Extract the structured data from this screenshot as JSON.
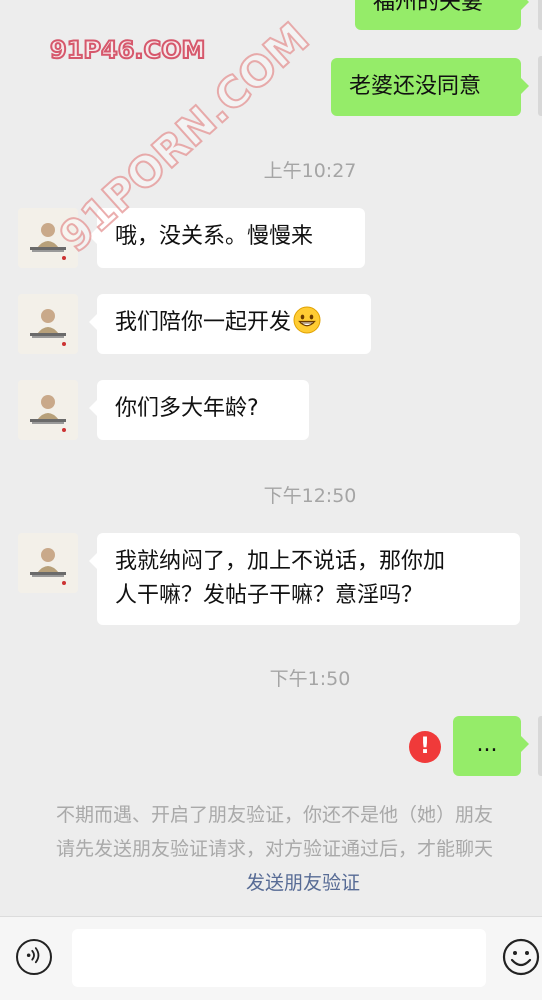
{
  "watermark": {
    "top": "91P46.COM",
    "diagonal": "91PORN.COM"
  },
  "messages": [
    {
      "side": "right",
      "text": "福州的夫妻",
      "partial": true
    },
    {
      "side": "right",
      "text": "老婆还没同意"
    },
    {
      "type": "time",
      "text": "上午10:27"
    },
    {
      "side": "left",
      "text": "哦，没关系。慢慢来"
    },
    {
      "side": "left",
      "text": "我们陪你一起开发",
      "emoji": "grinning-face"
    },
    {
      "side": "left",
      "text": "你们多大年龄?"
    },
    {
      "type": "time",
      "text": "下午12:50"
    },
    {
      "side": "left",
      "lines": [
        "我就纳闷了，加上不说话，那你加",
        "人干嘛？发帖子干嘛？意淫吗？"
      ]
    },
    {
      "type": "time",
      "text": "下午1:50"
    },
    {
      "side": "right",
      "text": "...",
      "failed": true
    }
  ],
  "system_notice": {
    "line1": "不期而遇、开启了朋友验证，你还不是他（她）朋友",
    "line2": "请先发送朋友验证请求，对方验证通过后，才能聊天",
    "link": "发送朋友验证"
  },
  "input_bar": {
    "voice_icon": "voice-icon",
    "emoji_icon": "emoji-icon",
    "placeholder": ""
  },
  "colors": {
    "background": "#ededed",
    "self_bubble": "#95ec69",
    "other_bubble": "#ffffff",
    "time_text": "#a5a5a5",
    "link": "#576b95",
    "error": "#f03a3a"
  }
}
